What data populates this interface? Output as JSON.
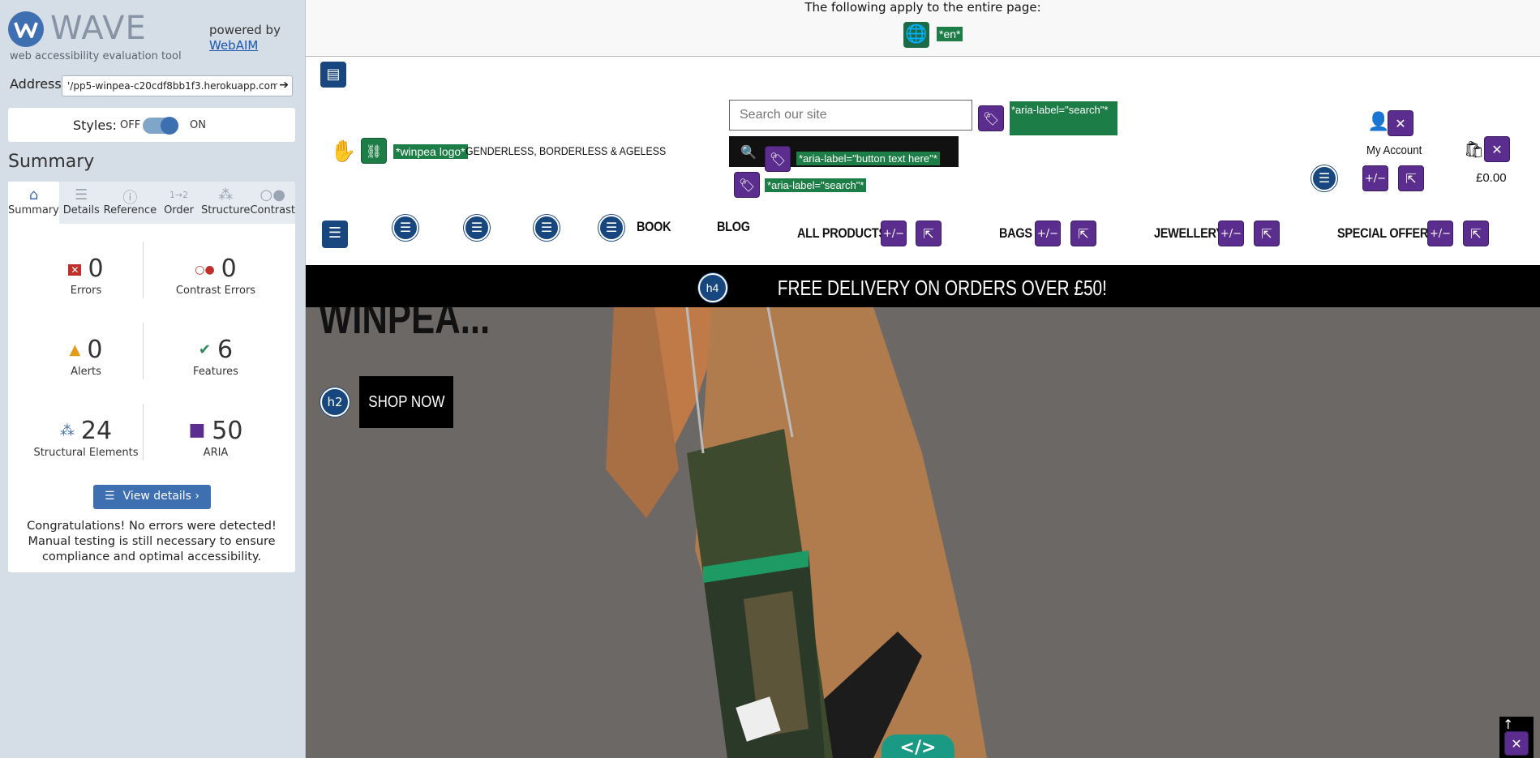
{
  "wave": {
    "logo_text": "WAVE",
    "subtitle": "web accessibility evaluation tool",
    "powered_by": "powered by",
    "webaim_link": "WebAIM",
    "address_label": "Address:",
    "address_value": "'/pp5-winpea-c20cdf8bb1f3.herokuapp.com/",
    "styles_label": "Styles:",
    "styles_off": "OFF",
    "styles_on": "ON",
    "summary_title": "Summary",
    "tabs": [
      {
        "label": "Summary",
        "icon": "home-icon"
      },
      {
        "label": "Details",
        "icon": "list-icon"
      },
      {
        "label": "Reference",
        "icon": "info-icon"
      },
      {
        "label": "Order",
        "icon": "order-icon"
      },
      {
        "label": "Structure",
        "icon": "structure-icon"
      },
      {
        "label": "Contrast",
        "icon": "contrast-icon"
      }
    ],
    "metrics": {
      "errors": {
        "value": "0",
        "label": "Errors"
      },
      "contrast_errors": {
        "value": "0",
        "label": "Contrast Errors"
      },
      "alerts": {
        "value": "0",
        "label": "Alerts"
      },
      "features": {
        "value": "6",
        "label": "Features"
      },
      "structural": {
        "value": "24",
        "label": "Structural Elements"
      },
      "aria": {
        "value": "50",
        "label": "ARIA"
      }
    },
    "view_details": "View details ›",
    "congrats": "Congratulations! No errors were detected! Manual testing is still necessary to ensure compliance and optimal accessibility."
  },
  "site": {
    "apply_text": "The following apply to the entire page:",
    "lang_tag": "*en*",
    "logo_aria": "*winpea logo*",
    "tagline": "GENDERLESS, BORDERLESS & AGELESS",
    "search_placeholder": "Search our site",
    "aria_search_1": "*aria-label=\"search\"*",
    "aria_button_text": "*aria-label=\"button text here\"*",
    "aria_search_2": "*aria-label=\"search\"*",
    "my_account": "My Account",
    "cart_total": "£0.00",
    "nav": {
      "book": "BOOK",
      "blog": "BLOG",
      "all_products": "ALL PRODUCTS",
      "bags": "BAGS",
      "jewellery": "JEWELLERY",
      "special_offers": "SPECIAL OFFERS"
    },
    "banner": "FREE DELIVERY ON ORDERS OVER £50!",
    "banner_tag": "h4",
    "hero_title": "WINPEA...",
    "shop_now": "SHOP NOW",
    "shop_tag": "h2",
    "code_icon": "</>"
  }
}
